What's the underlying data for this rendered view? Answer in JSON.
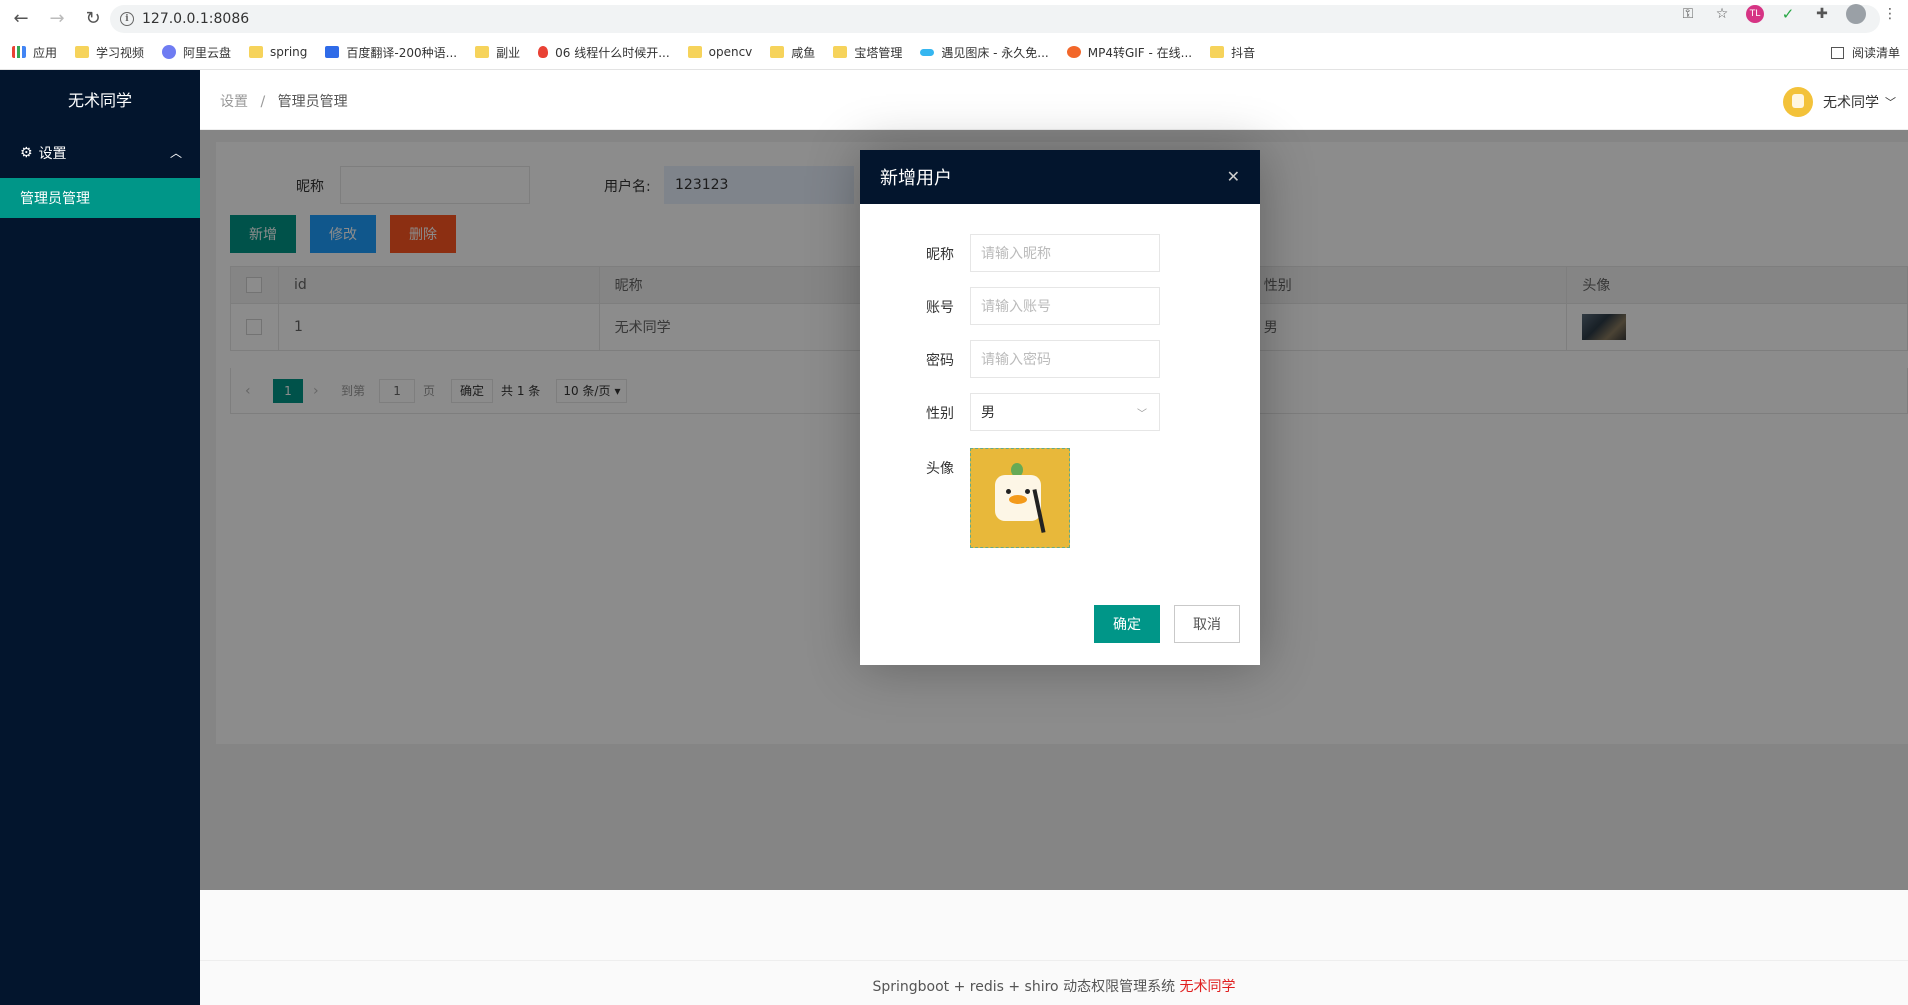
{
  "browser": {
    "url": "127.0.0.1:8086",
    "bookmarks": [
      {
        "label": "应用",
        "icon": "apps-icon"
      },
      {
        "label": "学习视频",
        "icon": "folder-icon"
      },
      {
        "label": "阿里云盘",
        "icon": "cloud-icon"
      },
      {
        "label": "spring",
        "icon": "folder-icon"
      },
      {
        "label": "百度翻译-200种语...",
        "icon": "translate-icon"
      },
      {
        "label": "副业",
        "icon": "folder-icon"
      },
      {
        "label": "06 线程什么时候开...",
        "icon": "fire-icon"
      },
      {
        "label": "opencv",
        "icon": "folder-icon"
      },
      {
        "label": "咸鱼",
        "icon": "folder-icon"
      },
      {
        "label": "宝塔管理",
        "icon": "folder-icon"
      },
      {
        "label": "遇见图床 - 永久免...",
        "icon": "link-icon"
      },
      {
        "label": "MP4转GIF - 在线...",
        "icon": "mp4-icon"
      },
      {
        "label": "抖音",
        "icon": "folder-icon"
      }
    ],
    "reading_list": "阅读清单"
  },
  "sidebar": {
    "brand": "无术同学",
    "group": "设置",
    "active_item": "管理员管理"
  },
  "header": {
    "breadcrumb_root": "设置",
    "breadcrumb_sep": "/",
    "breadcrumb_current": "管理员管理",
    "username": "无术同学"
  },
  "search": {
    "nickname_label": "昵称",
    "nickname_value": "",
    "username_label": "用户名:",
    "username_value": "123123"
  },
  "toolbar": {
    "add": "新增",
    "edit": "修改",
    "delete": "删除"
  },
  "table": {
    "columns": [
      "id",
      "昵称",
      "性别",
      "头像"
    ],
    "rows": [
      {
        "id": "1",
        "nickname": "无术同学",
        "gender": "男"
      }
    ]
  },
  "pager": {
    "current": "1",
    "goto_label": "到第",
    "goto_value": "1",
    "page_label": "页",
    "confirm": "确定",
    "total": "共 1 条",
    "page_size": "10 条/页"
  },
  "footer": {
    "text": "Springboot + redis + shiro 动态权限管理系统",
    "author": "无术同学"
  },
  "modal": {
    "title": "新增用户",
    "fields": {
      "nickname_label": "昵称",
      "nickname_placeholder": "请输入昵称",
      "account_label": "账号",
      "account_placeholder": "请输入账号",
      "password_label": "密码",
      "password_placeholder": "请输入密码",
      "gender_label": "性别",
      "gender_value": "男",
      "avatar_label": "头像"
    },
    "ok": "确定",
    "cancel": "取消"
  },
  "colors": {
    "sidebar_bg": "#03152d",
    "primary": "#009688",
    "blue": "#1e9fff",
    "red": "#ff5722"
  }
}
